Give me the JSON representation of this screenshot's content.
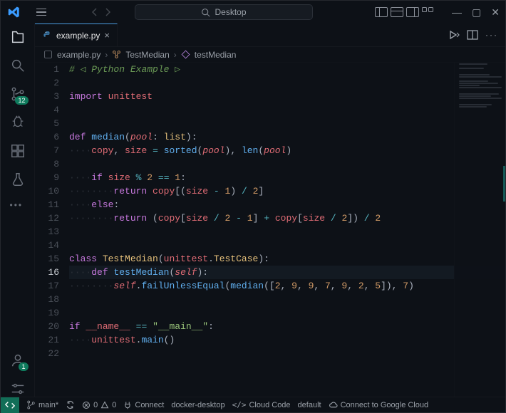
{
  "titlebar": {
    "search_placeholder": "Desktop"
  },
  "activity": {
    "scm_badge": "12",
    "accounts_badge": "1"
  },
  "tab": {
    "filename": "example.py"
  },
  "breadcrumbs": {
    "file": "example.py",
    "class": "TestMedian",
    "method": "testMedian"
  },
  "editor": {
    "lines": [
      [
        [
          "comment",
          "# ◁ Python Example ▷"
        ]
      ],
      [],
      [
        [
          "kw",
          "import"
        ],
        [
          "sp",
          " "
        ],
        [
          "var",
          "unittest"
        ]
      ],
      [],
      [],
      [
        [
          "kw",
          "def"
        ],
        [
          "sp",
          " "
        ],
        [
          "fn",
          "median"
        ],
        [
          "punc",
          "("
        ],
        [
          "param",
          "pool"
        ],
        [
          "punc",
          ": "
        ],
        [
          "builtin",
          "list"
        ],
        [
          "punc",
          "):"
        ]
      ],
      [
        [
          "ws",
          "····"
        ],
        [
          "var",
          "copy"
        ],
        [
          "punc",
          ", "
        ],
        [
          "var",
          "size"
        ],
        [
          "sp",
          " "
        ],
        [
          "op",
          "="
        ],
        [
          "sp",
          " "
        ],
        [
          "fn",
          "sorted"
        ],
        [
          "punc",
          "("
        ],
        [
          "param",
          "pool"
        ],
        [
          "punc",
          "), "
        ],
        [
          "fn",
          "len"
        ],
        [
          "punc",
          "("
        ],
        [
          "param",
          "pool"
        ],
        [
          "punc",
          ")"
        ]
      ],
      [],
      [
        [
          "ws",
          "····"
        ],
        [
          "kw",
          "if"
        ],
        [
          "sp",
          " "
        ],
        [
          "var",
          "size"
        ],
        [
          "sp",
          " "
        ],
        [
          "op",
          "%"
        ],
        [
          "sp",
          " "
        ],
        [
          "num",
          "2"
        ],
        [
          "sp",
          " "
        ],
        [
          "op",
          "=="
        ],
        [
          "sp",
          " "
        ],
        [
          "num",
          "1"
        ],
        [
          "punc",
          ":"
        ]
      ],
      [
        [
          "ws",
          "········"
        ],
        [
          "kw",
          "return"
        ],
        [
          "sp",
          " "
        ],
        [
          "var",
          "copy"
        ],
        [
          "punc",
          "[("
        ],
        [
          "var",
          "size"
        ],
        [
          "sp",
          " "
        ],
        [
          "op",
          "-"
        ],
        [
          "sp",
          " "
        ],
        [
          "num",
          "1"
        ],
        [
          "punc",
          ")"
        ],
        [
          "sp",
          " "
        ],
        [
          "op",
          "/"
        ],
        [
          "sp",
          " "
        ],
        [
          "num",
          "2"
        ],
        [
          "punc",
          "]"
        ]
      ],
      [
        [
          "ws",
          "····"
        ],
        [
          "kw",
          "else"
        ],
        [
          "punc",
          ":"
        ]
      ],
      [
        [
          "ws",
          "········"
        ],
        [
          "kw",
          "return"
        ],
        [
          "sp",
          " "
        ],
        [
          "punc",
          "("
        ],
        [
          "var",
          "copy"
        ],
        [
          "punc",
          "["
        ],
        [
          "var",
          "size"
        ],
        [
          "sp",
          " "
        ],
        [
          "op",
          "/"
        ],
        [
          "sp",
          " "
        ],
        [
          "num",
          "2"
        ],
        [
          "sp",
          " "
        ],
        [
          "op",
          "-"
        ],
        [
          "sp",
          " "
        ],
        [
          "num",
          "1"
        ],
        [
          "punc",
          "]"
        ],
        [
          "sp",
          " "
        ],
        [
          "op",
          "+"
        ],
        [
          "sp",
          " "
        ],
        [
          "var",
          "copy"
        ],
        [
          "punc",
          "["
        ],
        [
          "var",
          "size"
        ],
        [
          "sp",
          " "
        ],
        [
          "op",
          "/"
        ],
        [
          "sp",
          " "
        ],
        [
          "num",
          "2"
        ],
        [
          "punc",
          "])"
        ],
        [
          "sp",
          " "
        ],
        [
          "op",
          "/"
        ],
        [
          "sp",
          " "
        ],
        [
          "num",
          "2"
        ]
      ],
      [],
      [],
      [
        [
          "kw",
          "class"
        ],
        [
          "sp",
          " "
        ],
        [
          "cls",
          "TestMedian"
        ],
        [
          "punc",
          "("
        ],
        [
          "var",
          "unittest"
        ],
        [
          "punc",
          "."
        ],
        [
          "cls",
          "TestCase"
        ],
        [
          "punc",
          "):"
        ]
      ],
      [
        [
          "ws",
          "····"
        ],
        [
          "kw",
          "def"
        ],
        [
          "sp",
          " "
        ],
        [
          "fn",
          "testMedian"
        ],
        [
          "punc",
          "("
        ],
        [
          "param",
          "self"
        ],
        [
          "punc",
          "):"
        ]
      ],
      [
        [
          "ws",
          "········"
        ],
        [
          "param",
          "self"
        ],
        [
          "punc",
          "."
        ],
        [
          "fn",
          "failUnlessEqual"
        ],
        [
          "punc",
          "("
        ],
        [
          "fn",
          "median"
        ],
        [
          "punc",
          "(["
        ],
        [
          "num",
          "2"
        ],
        [
          "punc",
          ", "
        ],
        [
          "num",
          "9"
        ],
        [
          "punc",
          ", "
        ],
        [
          "num",
          "9"
        ],
        [
          "punc",
          ", "
        ],
        [
          "num",
          "7"
        ],
        [
          "punc",
          ", "
        ],
        [
          "num",
          "9"
        ],
        [
          "punc",
          ", "
        ],
        [
          "num",
          "2"
        ],
        [
          "punc",
          ", "
        ],
        [
          "num",
          "5"
        ],
        [
          "punc",
          "]), "
        ],
        [
          "num",
          "7"
        ],
        [
          "punc",
          ")"
        ]
      ],
      [],
      [],
      [
        [
          "kw",
          "if"
        ],
        [
          "sp",
          " "
        ],
        [
          "var",
          "__name__"
        ],
        [
          "sp",
          " "
        ],
        [
          "op",
          "=="
        ],
        [
          "sp",
          " "
        ],
        [
          "str",
          "\"__main__\""
        ],
        [
          "punc",
          ":"
        ]
      ],
      [
        [
          "ws",
          "····"
        ],
        [
          "var",
          "unittest"
        ],
        [
          "punc",
          "."
        ],
        [
          "fn",
          "main"
        ],
        [
          "punc",
          "()"
        ]
      ],
      []
    ],
    "current_line": 16
  },
  "status": {
    "branch": "main*",
    "errors": "0",
    "warnings": "0",
    "connect": "Connect",
    "context": "docker-desktop",
    "cloud_code": "Cloud Code",
    "project": "default",
    "gcp": "Connect to Google Cloud"
  }
}
